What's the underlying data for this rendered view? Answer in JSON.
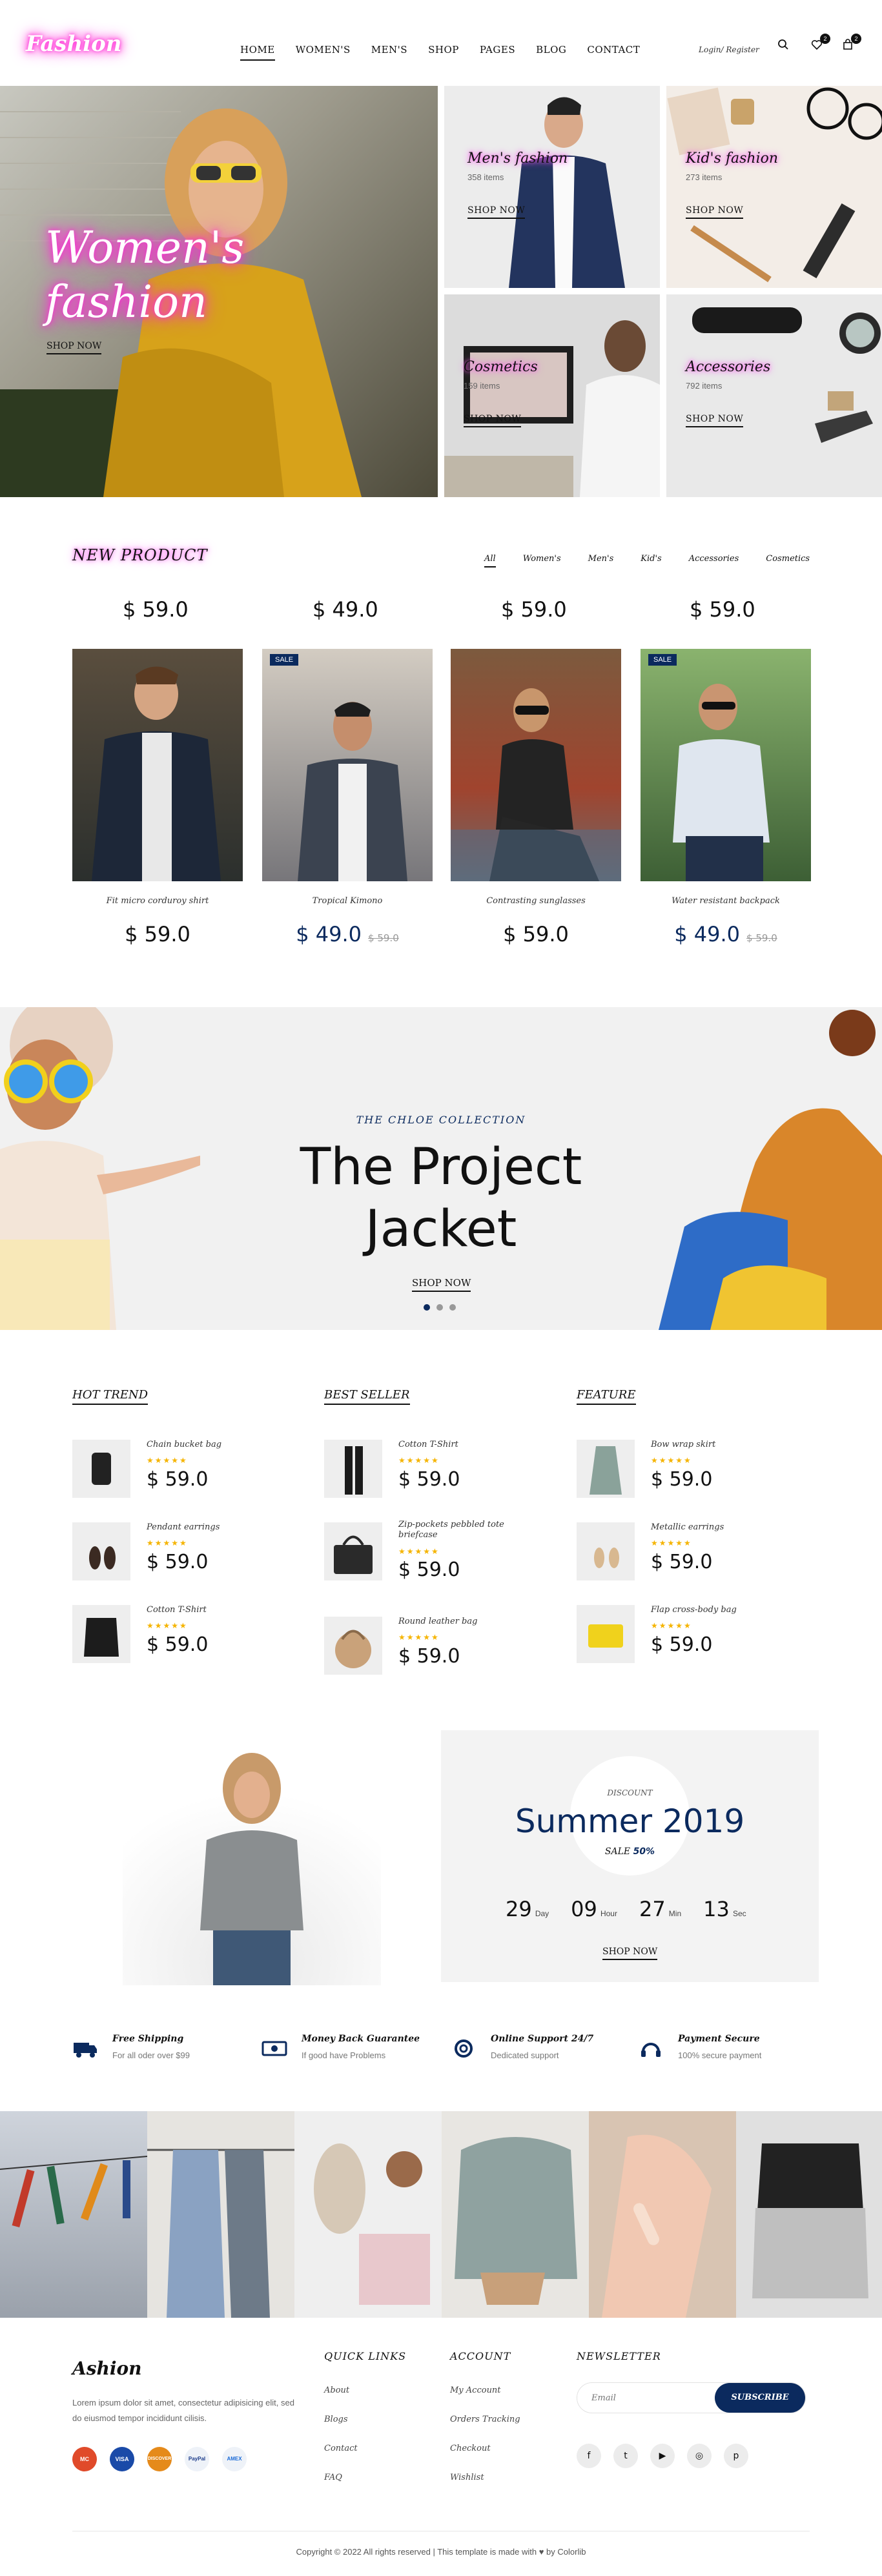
{
  "header": {
    "logo": "Fashion",
    "nav": [
      "HOME",
      "WOMEN'S",
      "MEN'S",
      "SHOP",
      "PAGES",
      "BLOG",
      "CONTACT"
    ],
    "login": "Login/",
    "register": "Register",
    "wishlist_count": "2",
    "cart_count": "2"
  },
  "hero": {
    "main_title_line1": "Women's",
    "main_title_line2": "fashion",
    "main_link": "SHOP NOW",
    "tiles": [
      {
        "title": "Men's fashion",
        "sub": "358 items",
        "link": "SHOP NOW"
      },
      {
        "title": "Kid's fashion",
        "sub": "273 items",
        "link": "SHOP NOW"
      },
      {
        "title": "Cosmetics",
        "sub": "159 items",
        "link": "SHOP NOW"
      },
      {
        "title": "Accessories",
        "sub": "792 items",
        "link": "SHOP NOW"
      }
    ]
  },
  "new_product": {
    "title": "NEW PRODUCT",
    "filters": [
      "All",
      "Women's",
      "Men's",
      "Kid's",
      "Accessories",
      "Cosmetics"
    ],
    "top_prices": [
      "$ 59.0",
      "$ 49.0",
      "$ 59.0",
      "$ 59.0"
    ],
    "products": [
      {
        "name": "Fit micro corduroy shirt",
        "price": "$ 59.0",
        "old": "",
        "sale": ""
      },
      {
        "name": "Tropical Kimono",
        "price": "$ 49.0",
        "old": "$ 59.0",
        "sale": "SALE"
      },
      {
        "name": "Contrasting sunglasses",
        "price": "$ 59.0",
        "old": "",
        "sale": ""
      },
      {
        "name": "Water resistant backpack",
        "price": "$ 49.0",
        "old": "$ 59.0",
        "sale": "SALE"
      }
    ]
  },
  "banner": {
    "kicker": "THE CHLOE COLLECTION",
    "title_line1": "The Project",
    "title_line2": "Jacket",
    "link": "SHOP NOW"
  },
  "lists": [
    {
      "title": "HOT TREND",
      "items": [
        {
          "name": "Chain bucket bag",
          "price": "$ 59.0"
        },
        {
          "name": "Pendant earrings",
          "price": "$ 59.0"
        },
        {
          "name": "Cotton T-Shirt",
          "price": "$ 59.0"
        }
      ]
    },
    {
      "title": "BEST SELLER",
      "items": [
        {
          "name": "Cotton T-Shirt",
          "price": "$ 59.0"
        },
        {
          "name": "Zip-pockets pebbled tote briefcase",
          "price": "$ 59.0"
        },
        {
          "name": "Round leather bag",
          "price": "$ 59.0"
        }
      ]
    },
    {
      "title": "FEATURE",
      "items": [
        {
          "name": "Bow wrap skirt",
          "price": "$ 59.0"
        },
        {
          "name": "Metallic earrings",
          "price": "$ 59.0"
        },
        {
          "name": "Flap cross-body bag",
          "price": "$ 59.0"
        }
      ]
    }
  ],
  "summer": {
    "discount": "DISCOUNT",
    "title": "Summer 2019",
    "sale": "SALE",
    "sale_pct": "50%",
    "countdown": [
      {
        "value": "29",
        "unit": "Day"
      },
      {
        "value": "09",
        "unit": "Hour"
      },
      {
        "value": "27",
        "unit": "Min"
      },
      {
        "value": "13",
        "unit": "Sec"
      }
    ],
    "link": "SHOP NOW"
  },
  "features": [
    {
      "icon": "truck-icon",
      "title": "Free Shipping",
      "sub": "For all oder over $99"
    },
    {
      "icon": "money-icon",
      "title": "Money Back Guarantee",
      "sub": "If good have Problems"
    },
    {
      "icon": "support-icon",
      "title": "Online Support 24/7",
      "sub": "Dedicated support"
    },
    {
      "icon": "headphones-icon",
      "title": "Payment Secure",
      "sub": "100% secure payment"
    }
  ],
  "footer": {
    "logo": "Ashion",
    "about": "Lorem ipsum dolor sit amet, consectetur adipisicing elit, sed do eiusmod tempor incididunt cilisis.",
    "payments": [
      "MC",
      "VISA",
      "DISCOVER",
      "PayPal",
      "AMEX"
    ],
    "quick_title": "QUICK LINKS",
    "quick_links": [
      "About",
      "Blogs",
      "Contact",
      "FAQ"
    ],
    "account_title": "ACCOUNT",
    "account_links": [
      "My Account",
      "Orders Tracking",
      "Checkout",
      "Wishlist"
    ],
    "newsletter_title": "NEWSLETTER",
    "email_placeholder": "Email",
    "subscribe": "SUBSCRIBE",
    "copyright": "Copyright © 2022 All rights reserved | This template is made with ♥ by Colorlib"
  },
  "colors": {
    "accent": "#0b2a5e",
    "neon": "#ff2bd6",
    "star": "#f5b400"
  }
}
